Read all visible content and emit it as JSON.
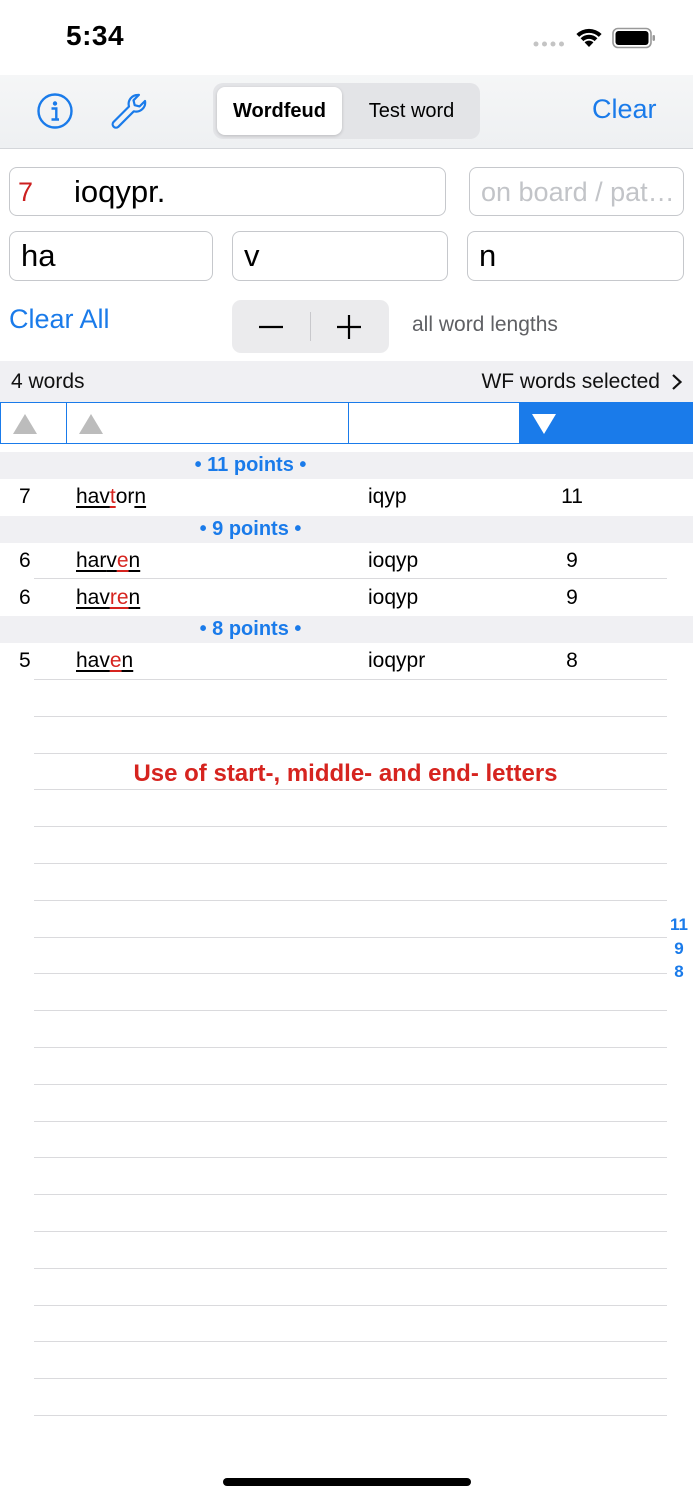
{
  "status_bar": {
    "time": "5:34"
  },
  "toolbar": {
    "segments": [
      "Wordfeud",
      "Test word"
    ],
    "selected_segment": "Wordfeud",
    "clear_label": "Clear",
    "icons": [
      "info-icon",
      "wrench-icon"
    ]
  },
  "inputs": {
    "letters_count": "7",
    "letters": "ioqypr.",
    "board_placeholder": "on board / pattern",
    "start": "ha",
    "middle": "v",
    "end": "n"
  },
  "controls": {
    "clear_all_label": "Clear All",
    "stepper_minus": "−",
    "stepper_plus": "+",
    "word_lengths": "all word lengths"
  },
  "info_bar": {
    "word_count": "4 words",
    "selection": "WF words selected"
  },
  "sections": [
    {
      "title": "• 11 points •",
      "rows": [
        {
          "length": "7",
          "word": "havtorn",
          "rest": "iqyp",
          "score": "11",
          "word_parts": [
            {
              "t": "hav",
              "s": "u"
            },
            {
              "t": "t",
              "s": "r"
            },
            {
              "t": "or",
              "s": ""
            },
            {
              "t": "n",
              "s": "u"
            }
          ]
        }
      ]
    },
    {
      "title": "• 9 points •",
      "rows": [
        {
          "length": "6",
          "word": "harven",
          "rest": "ioqyp",
          "score": "9",
          "word_parts": [
            {
              "t": "har",
              "s": "u"
            },
            {
              "t": "v",
              "s": "u"
            },
            {
              "t": "e",
              "s": "r"
            },
            {
              "t": "n",
              "s": "u"
            }
          ]
        },
        {
          "length": "6",
          "word": "havren",
          "rest": "ioqyp",
          "score": "9",
          "word_parts": [
            {
              "t": "hav",
              "s": "u"
            },
            {
              "t": "re",
              "s": "r"
            },
            {
              "t": "n",
              "s": "u"
            }
          ]
        }
      ]
    },
    {
      "title": "• 8 points •",
      "rows": [
        {
          "length": "5",
          "word": "haven",
          "rest": "ioqypr",
          "score": "8",
          "word_parts": [
            {
              "t": "hav",
              "s": "u"
            },
            {
              "t": "e",
              "s": "r"
            },
            {
              "t": "n",
              "s": "u"
            }
          ]
        }
      ]
    }
  ],
  "message": "Use of start-, middle- and end- letters",
  "index": [
    "11",
    "9",
    "8"
  ],
  "colors": {
    "accent": "#1a7bea",
    "highlight": "#d6241f",
    "section_bg": "#f0f0f3"
  }
}
